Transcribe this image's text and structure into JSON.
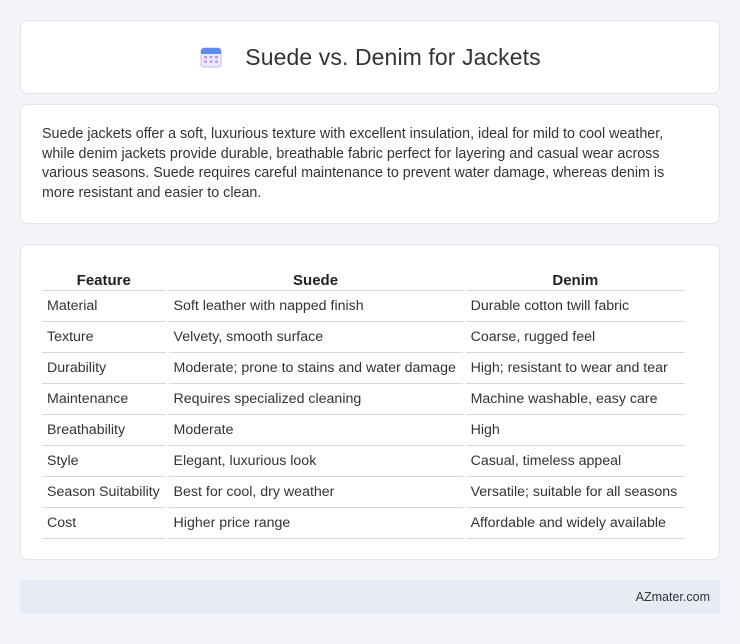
{
  "header": {
    "title": "Suede vs. Denim for Jackets",
    "icon": "calendar-icon"
  },
  "summary": {
    "text": "Suede jackets offer a soft, luxurious texture with excellent insulation, ideal for mild to cool weather, while denim jackets provide durable, breathable fabric perfect for layering and casual wear across various seasons. Suede requires careful maintenance to prevent water damage, whereas denim is more resistant and easier to clean."
  },
  "table": {
    "headers": [
      "Feature",
      "Suede",
      "Denim"
    ],
    "rows": [
      [
        "Material",
        "Soft leather with napped finish",
        "Durable cotton twill fabric"
      ],
      [
        "Texture",
        "Velvety, smooth surface",
        "Coarse, rugged feel"
      ],
      [
        "Durability",
        "Moderate; prone to stains and water damage",
        "High; resistant to wear and tear"
      ],
      [
        "Maintenance",
        "Requires specialized cleaning",
        "Machine washable, easy care"
      ],
      [
        "Breathability",
        "Moderate",
        "High"
      ],
      [
        "Style",
        "Elegant, luxurious look",
        "Casual, timeless appeal"
      ],
      [
        "Season Suitability",
        "Best for cool, dry weather",
        "Versatile; suitable for all seasons"
      ],
      [
        "Cost",
        "Higher price range",
        "Affordable and widely available"
      ]
    ]
  },
  "footer": {
    "text": "AZmater.com"
  },
  "colors": {
    "background": "#f3f4f8",
    "footer_bg": "#e6ebf6",
    "icon_top": "#5b8def",
    "icon_grid": "#b59be6"
  }
}
